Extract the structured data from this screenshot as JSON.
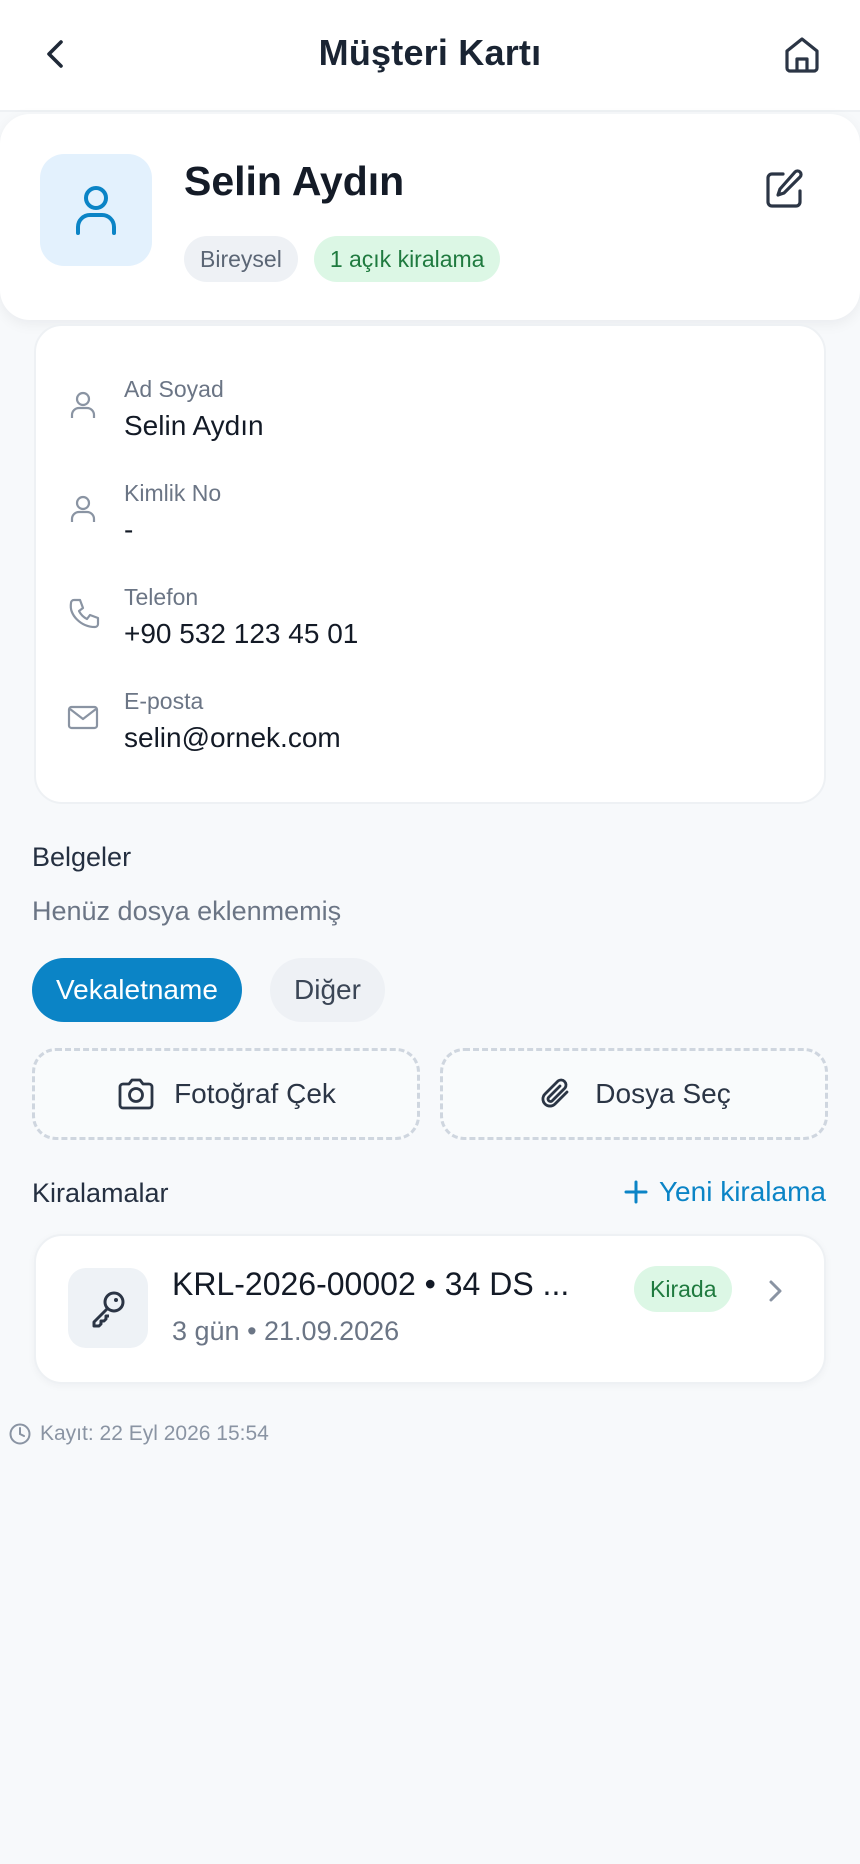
{
  "header": {
    "title": "Müşteri Kartı",
    "back_icon": "chevron-left-icon",
    "home_icon": "home-icon"
  },
  "profile": {
    "name": "Selin Aydın",
    "avatar_icon": "user-icon",
    "edit_icon": "edit-icon",
    "badges": [
      "Bireysel",
      "1 açık kiralama"
    ]
  },
  "info": {
    "fields": [
      {
        "label": "Ad Soyad",
        "value": "Selin Aydın",
        "icon": "user-icon"
      },
      {
        "label": "Kimlik No",
        "value": "-",
        "icon": "user-icon"
      },
      {
        "label": "Telefon",
        "value": "+90 532 123 45 01",
        "icon": "phone-icon"
      },
      {
        "label": "E-posta",
        "value": "selin@ornek.com",
        "icon": "mail-icon"
      }
    ]
  },
  "documents": {
    "title": "Belgeler",
    "empty_text": "Henüz dosya eklenmemiş",
    "chips": [
      "Vekaletname",
      "Diğer"
    ],
    "selected_chip": "Vekaletname",
    "take_photo_label": "Fotoğraf Çek",
    "choose_file_label": "Dosya Seç"
  },
  "rentals": {
    "title": "Kiralamalar",
    "new_label": "Yeni kiralama",
    "items": [
      {
        "title": "KRL-2026-00002 • 34 DS ...",
        "subtitle": "3 gün • 21.09.2026",
        "status": "Kirada"
      }
    ]
  },
  "meta": {
    "created_text": "Kayıt: 22 Eyl 2026 15:54"
  },
  "colors": {
    "accent": "#0b84c6",
    "success_bg": "#dcf7e5",
    "success_text": "#1f7a3f"
  }
}
